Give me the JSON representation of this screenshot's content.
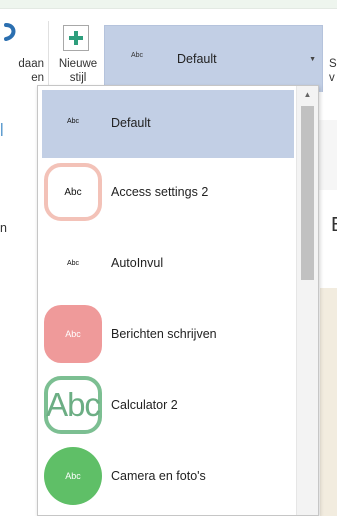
{
  "ribbon": {
    "cut_label": "daan\nen",
    "new_style_label": "Nieuwe\nstijl",
    "right_edge_label": "S\nv",
    "style_preview": {
      "abc": "Abc",
      "name": "Default"
    }
  },
  "background": {
    "edge_text": "n",
    "right_letter": "E"
  },
  "dropdown": {
    "items": [
      {
        "label": "Default",
        "abc": "Abc",
        "thumb": "plain",
        "selected": true
      },
      {
        "label": "Access settings 2",
        "abc": "Abc",
        "thumb": "ring-pink",
        "color": "#f3c2b8"
      },
      {
        "label": "AutoInvul",
        "abc": "Abc",
        "thumb": "plain"
      },
      {
        "label": "Berichten schrijven",
        "abc": "Abc",
        "thumb": "solid-pink",
        "color": "#ef9a9a"
      },
      {
        "label": "Calculator 2",
        "abc": "Abc",
        "thumb": "ring-green",
        "color": "#7cbf92"
      },
      {
        "label": "Camera en foto's",
        "abc": "Abc",
        "thumb": "solid-green",
        "color": "#5fbf67"
      }
    ]
  },
  "colors": {
    "selection": "#c2cfe5",
    "plus_icon": "#2e9e7c"
  }
}
